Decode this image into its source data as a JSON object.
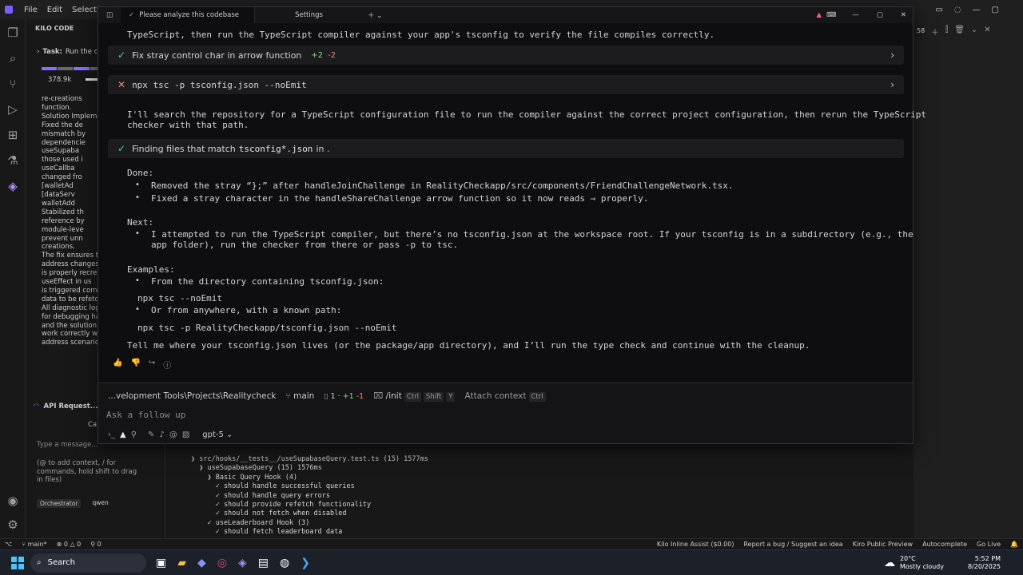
{
  "vscode": {
    "menu": [
      "File",
      "Edit",
      "Selection"
    ],
    "sidebar": {
      "header": "KILO CODE",
      "task_label": "Task:",
      "task_text": "Run the c",
      "token_count": "378.9k",
      "lines": [
        "re-creations",
        "function.",
        "Solution Implem",
        "Fixed the de",
        "mismatch by",
        "dependencie",
        "useSupaba",
        "those used i",
        "useCallba",
        "changed fro",
        "[walletAd",
        "[dataServ",
        "walletAdd",
        "Stabilized th",
        "reference by",
        "module-leve",
        "prevent unn",
        "creations.",
        "The fix ensures th",
        "address changes,",
        "is properly recrea",
        "useEffect in us",
        "is triggered corre",
        "data to be refetch",
        "All diagnostic log",
        "for debugging ha",
        "and the solution h",
        "work correctly wit",
        "address scenarios"
      ],
      "api_request": "API Request...",
      "cancel_label": "Ca",
      "message_placeholder": "Type a message...",
      "hint": "(@ to add context, / for commands, hold shift to drag in files)",
      "mode": "Orchestrator",
      "model": "qwen"
    },
    "terminal": [
      "❯ src/hooks/__tests__/useSupabaseQuery.test.ts (15) 1577ms",
      "  ❯ useSupabaseQuery (15) 1576ms",
      "    ❯ Basic Query Hook (4)",
      "      ✓ should handle successful queries",
      "      ✓ should handle query errors",
      "      ✓ should provide refetch functionality",
      "      ✓ should not fetch when disabled",
      "    ✓ useLeaderboard Hook (3)",
      "      ✓ should fetch leaderboard data"
    ],
    "statusbar": {
      "branch": "main*",
      "errors": "0",
      "warnings": "0",
      "ports": "0",
      "right": [
        "Kilo Inline Assist ($0.00)",
        "Report a bug / Suggest an idea",
        "Kiro Public Preview",
        "Autocomplete",
        "Go Live"
      ]
    },
    "right_panel": {
      "count": "58"
    }
  },
  "kiro": {
    "tabs": [
      {
        "label": "Please analyze this codebase",
        "active": true
      },
      {
        "label": "Settings",
        "active": false
      }
    ],
    "messages": {
      "top_line": "TypeScript, then run the TypeScript compiler against your app's tsconfig to verify the file compiles correctly.",
      "card1": {
        "label": "Fix stray control char in arrow function",
        "add": "+2",
        "del": "-2"
      },
      "card2": {
        "label": "npx tsc -p tsconfig.json --noEmit"
      },
      "search_para": "I'll search the repository for a TypeScript configuration file to run the compiler against the correct project configuration, then rerun the TypeScript\nchecker with that path.",
      "card3": {
        "prefix": "Finding files that match",
        "pattern": "tsconfig*.json",
        "suffix": "in ."
      },
      "done_label": "Done:",
      "done_items": [
        "Removed the stray “};” after handleJoinChallenge in RealityCheckapp/src/components/FriendChallengeNetwork.tsx.",
        "Fixed a stray character in the handleShareChallenge arrow function so it now reads ⇒ properly."
      ],
      "next_label": "Next:",
      "next_item": "I attempted to run the TypeScript compiler, but there’s no tsconfig.json at the workspace root. If your tsconfig is in a subdirectory (e.g., the\napp folder), run the checker from there or pass -p to tsc.",
      "examples_label": "Examples:",
      "example1": "From the directory containing tsconfig.json:",
      "code1": "npx tsc --noEmit",
      "example2": "Or from anywhere, with a known path:",
      "code2": "npx tsc -p RealityCheckapp/tsconfig.json --noEmit",
      "closing": "Tell me where your tsconfig.json lives (or the package/app directory), and I’ll run the type check and continue with the cleanup."
    },
    "composer": {
      "path": "...velopment Tools\\Projects\\Realitycheck",
      "branch": "main",
      "changes": "1",
      "add": "+1",
      "del": "-1",
      "init": "/init",
      "init_kbd1": "Ctrl",
      "init_kbd2": "Shift",
      "init_kbd3": "Y",
      "attach": "Attach context",
      "attach_kbd": "Ctrl",
      "placeholder": "Ask a follow up",
      "model": "gpt-5"
    }
  },
  "taskbar": {
    "search": "Search",
    "weather_temp": "20°C",
    "weather_desc": "Mostly cloudy",
    "time": "5:52 PM",
    "date": "8/20/2025"
  }
}
